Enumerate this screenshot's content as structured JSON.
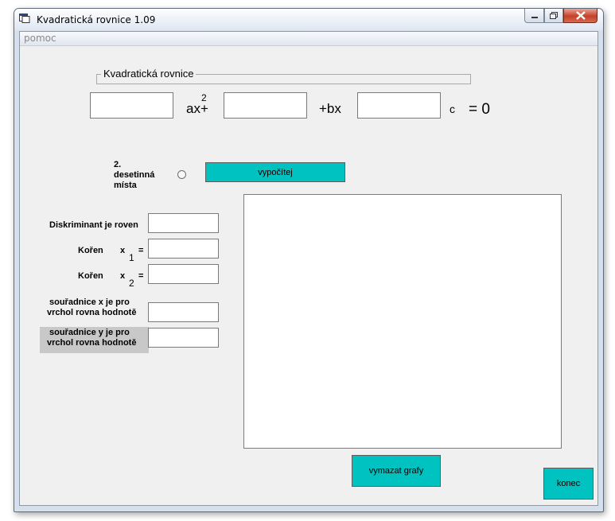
{
  "window": {
    "title": "Kvadratická rovnice 1.09"
  },
  "menu": {
    "items": [
      {
        "label": "pomoc"
      }
    ]
  },
  "group": {
    "label": "Kvadratická rovnice"
  },
  "equation": {
    "a_value": "",
    "b_value": "",
    "c_value": "",
    "exponent": "2",
    "term_ax": "ax+",
    "term_bx": "+bx",
    "term_c": "c",
    "equals": "= 0"
  },
  "options": {
    "decimal_label_1": "2.",
    "decimal_label_2": "desetinná",
    "decimal_label_3": "místa",
    "radio_checked": false
  },
  "buttons": {
    "calculate": "vypočítej",
    "clear_graphs": "vymazat grafy",
    "exit": "konec"
  },
  "results": {
    "discriminant_label": "Diskriminant je roven",
    "root1_label": "Kořen",
    "root1_var": "x",
    "root1_sub": "1",
    "root2_label": "Kořen",
    "root2_var": "x",
    "root2_sub": "2",
    "equals_sign": "=",
    "vertex_x_line1": "souřadnice x je pro",
    "vertex_x_line2": "vrchol rovna hodnotě",
    "vertex_y_line1": "souřadnice y je pro",
    "vertex_y_line2": "vrchol rovna hodnotě",
    "discriminant_value": "",
    "root1_value": "",
    "root2_value": "",
    "vertex_x_value": "",
    "vertex_y_value": ""
  }
}
